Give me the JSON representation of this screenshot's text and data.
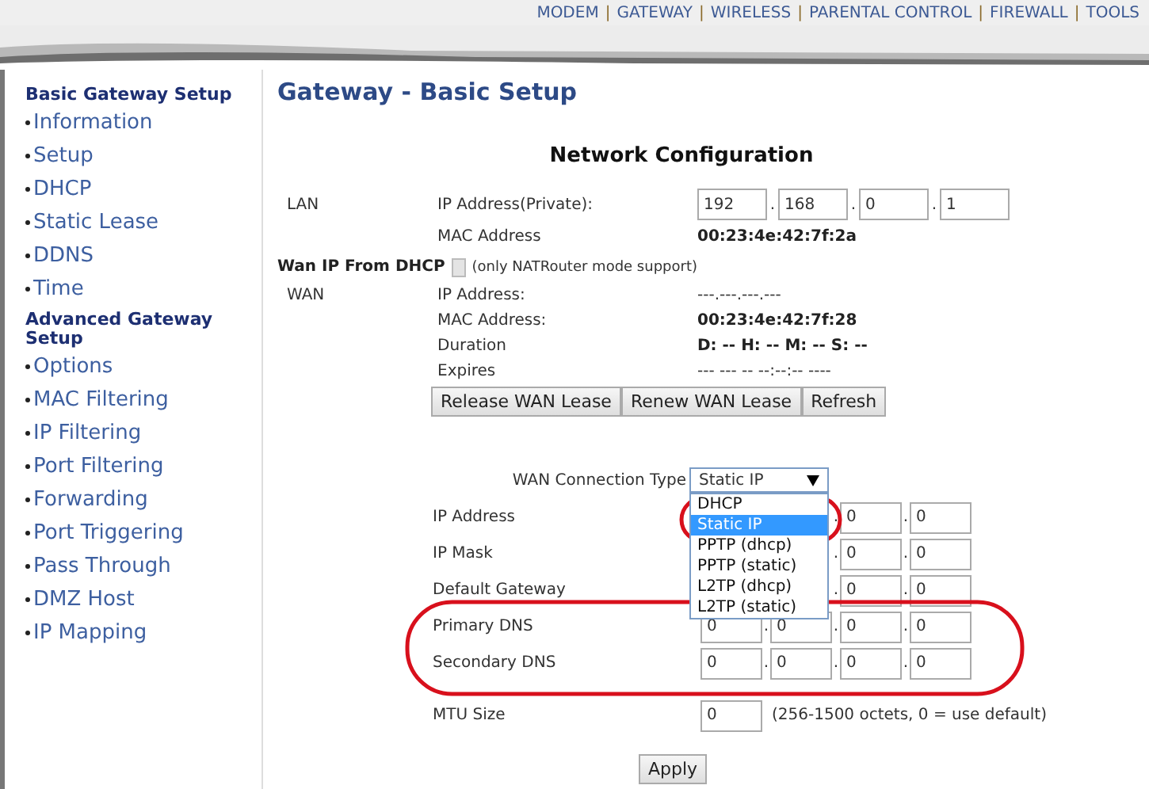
{
  "top_nav": {
    "separator": "|",
    "links": [
      {
        "label": "MODEM"
      },
      {
        "label": "GATEWAY"
      },
      {
        "label": "WIRELESS"
      },
      {
        "label": "PARENTAL CONTROL"
      },
      {
        "label": "FIREWALL"
      },
      {
        "label": "TOOLS"
      }
    ]
  },
  "sidebar": {
    "sections": [
      {
        "title": "Basic Gateway Setup",
        "items": [
          {
            "label": "Information"
          },
          {
            "label": "Setup"
          },
          {
            "label": "DHCP"
          },
          {
            "label": "Static Lease"
          },
          {
            "label": "DDNS"
          },
          {
            "label": "Time"
          }
        ]
      },
      {
        "title": "Advanced Gateway Setup",
        "items": [
          {
            "label": "Options"
          },
          {
            "label": "MAC Filtering"
          },
          {
            "label": "IP Filtering"
          },
          {
            "label": "Port Filtering"
          },
          {
            "label": "Forwarding"
          },
          {
            "label": "Port Triggering"
          },
          {
            "label": "Pass Through"
          },
          {
            "label": "DMZ Host"
          },
          {
            "label": "IP Mapping"
          }
        ]
      }
    ]
  },
  "page_title": "Gateway - Basic Setup",
  "section_title": "Network Configuration",
  "octet_separator": ".",
  "lan": {
    "label": "LAN",
    "ip_label": "IP Address(Private):",
    "ip_octets": [
      "192",
      "168",
      "0",
      "1"
    ],
    "mac_label": "MAC Address",
    "mac": "00:23:4e:42:7f:2a"
  },
  "wan_dhcp": {
    "label": "Wan IP From DHCP",
    "checked": false,
    "disabled": true,
    "note": "(only NATRouter mode support)"
  },
  "wan": {
    "label": "WAN",
    "rows": [
      {
        "label": "IP Address:",
        "value": "---.---.---.---",
        "bold": false
      },
      {
        "label": "MAC Address:",
        "value": "00:23:4e:42:7f:28",
        "bold": true
      },
      {
        "label": "Duration",
        "value": "D: -- H: -- M: -- S: --",
        "bold": true
      },
      {
        "label": "Expires",
        "value": "--- --- -- --:--:-- ----",
        "bold": false
      }
    ]
  },
  "wan_buttons": [
    "Release WAN Lease",
    "Renew WAN Lease",
    "Refresh"
  ],
  "connection_type": {
    "label": "WAN Connection Type",
    "value": "Static IP",
    "expanded": true,
    "options": [
      {
        "label": "DHCP",
        "selected": false
      },
      {
        "label": "Static IP",
        "selected": true
      },
      {
        "label": "PPTP (dhcp)",
        "selected": false
      },
      {
        "label": "PPTP (static)",
        "selected": false
      },
      {
        "label": "L2TP (dhcp)",
        "selected": false
      },
      {
        "label": "L2TP (static)",
        "selected": false
      }
    ]
  },
  "static_fields": [
    {
      "label": "IP Address",
      "octets": [
        "0",
        "0"
      ]
    },
    {
      "label": "IP Mask",
      "octets": [
        "0",
        "0"
      ]
    },
    {
      "label": "Default Gateway",
      "octets": [
        "0",
        "0"
      ]
    },
    {
      "label": "Primary DNS",
      "octets": [
        "0",
        "0",
        "0",
        "0"
      ]
    },
    {
      "label": "Secondary DNS",
      "octets": [
        "0",
        "0",
        "0",
        "0"
      ]
    }
  ],
  "mtu": {
    "label": "MTU Size",
    "value": "0",
    "hint": "(256-1500 octets, 0 = use default)"
  },
  "apply_button": "Apply",
  "annotations": [
    {
      "kind": "ellipse",
      "color": "#d8101c"
    },
    {
      "kind": "ellipse",
      "color": "#d8101c"
    }
  ]
}
